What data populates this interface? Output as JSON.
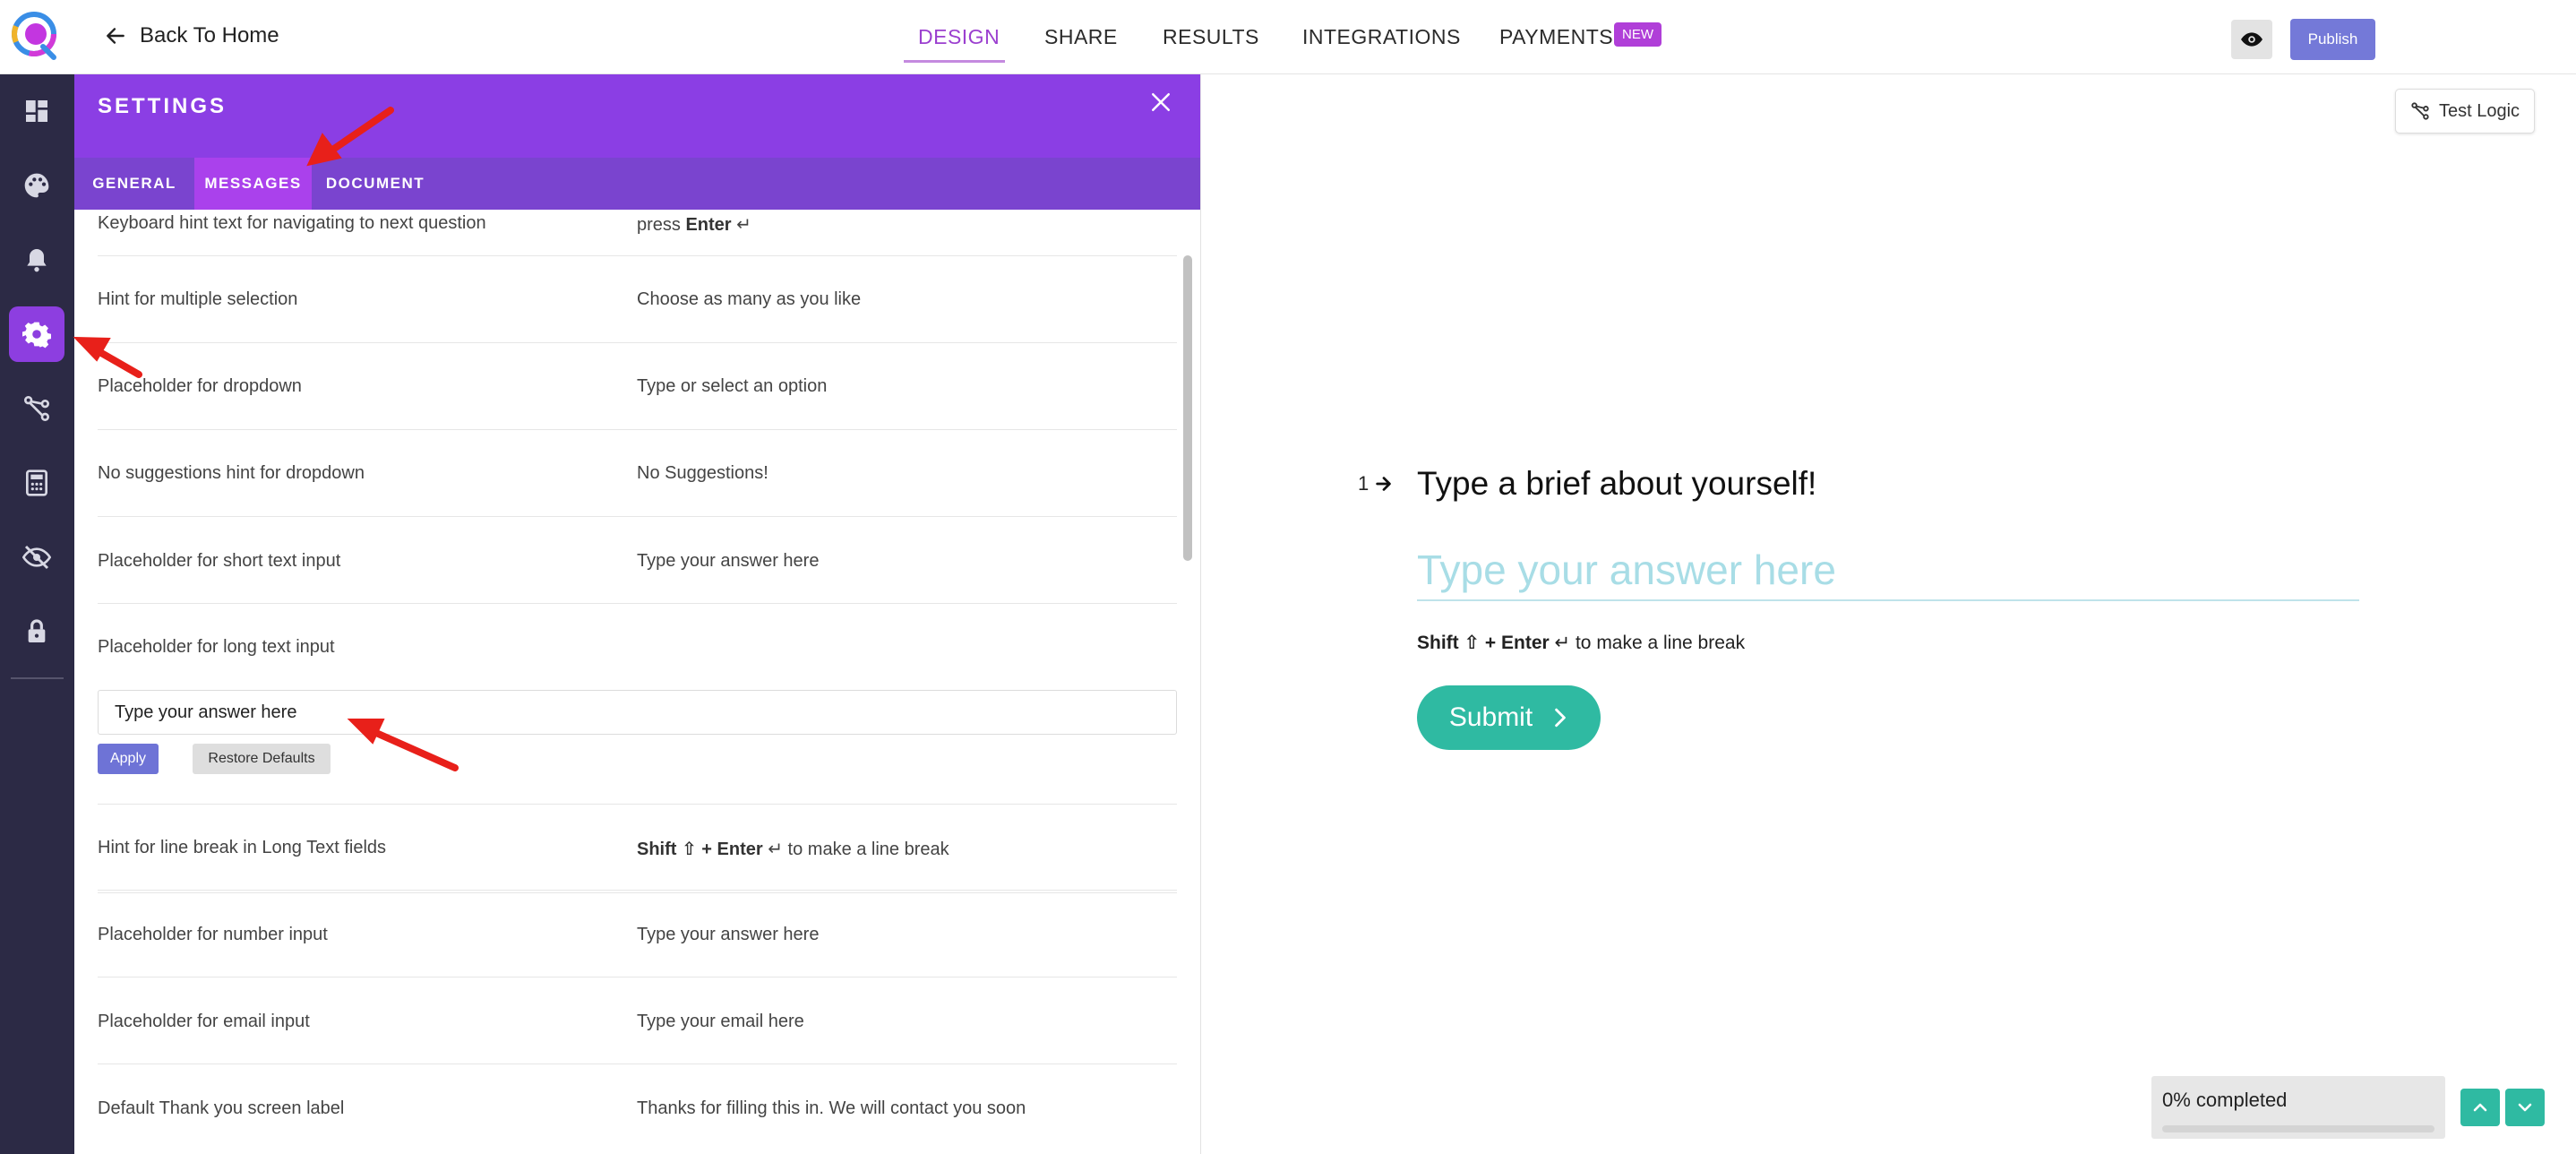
{
  "header": {
    "back_label": "Back To Home",
    "nav": [
      {
        "label": "DESIGN",
        "active": true
      },
      {
        "label": "SHARE",
        "active": false
      },
      {
        "label": "RESULTS",
        "active": false
      },
      {
        "label": "INTEGRATIONS",
        "active": false
      },
      {
        "label": "PAYMENTS",
        "active": false
      }
    ],
    "new_badge": "NEW",
    "publish_label": "Publish"
  },
  "sidebar": {
    "items": [
      {
        "icon": "dashboard-icon",
        "active": false
      },
      {
        "icon": "palette-icon",
        "active": false
      },
      {
        "icon": "bell-icon",
        "active": false
      },
      {
        "icon": "gear-icon",
        "active": true
      },
      {
        "icon": "branch-icon",
        "active": false
      },
      {
        "icon": "calculator-icon",
        "active": false
      },
      {
        "icon": "eye-slash-icon",
        "active": false
      },
      {
        "icon": "lock-icon",
        "active": false
      }
    ]
  },
  "settings": {
    "title": "SETTINGS",
    "tabs": [
      {
        "label": "GENERAL",
        "active": false
      },
      {
        "label": "MESSAGES",
        "active": true
      },
      {
        "label": "DOCUMENT",
        "active": false
      }
    ],
    "rows": [
      {
        "label": "Keyboard hint text for navigating to next question",
        "value_pre": "press ",
        "value_bold": "Enter",
        "value_post": " ↵"
      },
      {
        "label": "Hint for multiple selection",
        "value": "Choose as many as you like"
      },
      {
        "label": "Placeholder for dropdown",
        "value": "Type or select an option"
      },
      {
        "label": "No suggestions hint for dropdown",
        "value": "No Suggestions!"
      },
      {
        "label": "Placeholder for short text input",
        "value": "Type your answer here"
      },
      {
        "label": "Placeholder for long text input",
        "editing": true,
        "input_value": "Type your answer here"
      },
      {
        "label": "Hint for line break in Long Text fields",
        "value_bold": "Shift ⇧ + Enter",
        "value_post": " ↵ to make a line break"
      },
      {
        "label": "Placeholder for number input",
        "value": "Type your answer here"
      },
      {
        "label": "Placeholder for email input",
        "value": "Type your email here"
      },
      {
        "label": "Default Thank you screen label",
        "value": "Thanks for filling this in. We will contact you soon"
      }
    ],
    "apply_label": "Apply",
    "restore_label": "Restore Defaults"
  },
  "preview": {
    "test_logic_label": "Test Logic",
    "question_number": "1",
    "question_title": "Type a brief about yourself!",
    "answer_placeholder": "Type your answer here",
    "hint_bold": "Shift ⇧ + Enter",
    "hint_rest": " ↵ to make a line break",
    "submit_label": "Submit",
    "progress_text": "0% completed",
    "progress_value": 0
  },
  "colors": {
    "accent_purple": "#8b3ee4",
    "tab_bar": "#7a44cf",
    "active_tab": "#aa41ec",
    "sidebar_bg": "#2c2a45",
    "teal": "#2fbaa2",
    "publish": "#7479d8",
    "annotation_red": "#e8201a"
  }
}
